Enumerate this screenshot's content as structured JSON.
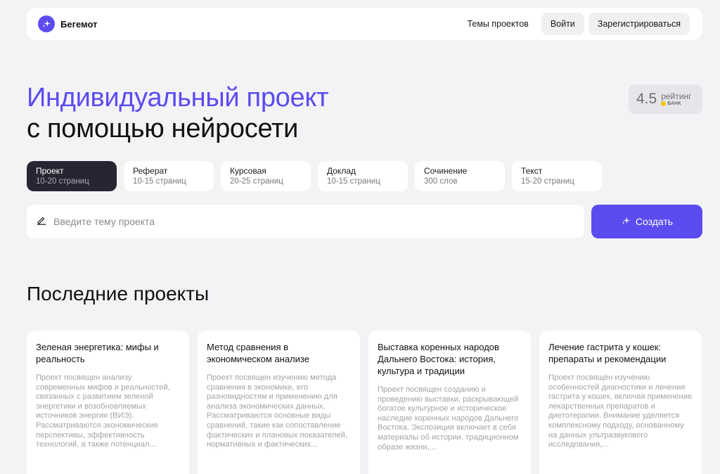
{
  "header": {
    "logo_text": "Бегемот",
    "nav_topics": "Темы проектов",
    "login": "Войти",
    "register": "Зарегистрироваться"
  },
  "hero": {
    "title_line1": "Индивидуальный проект",
    "title_line2": "с помощью нейросети"
  },
  "rating": {
    "value": "4.5",
    "label": "рейтинг",
    "bank": "БАНК"
  },
  "types": [
    {
      "name": "Проект",
      "sub": "10-20 страниц",
      "active": true
    },
    {
      "name": "Реферат",
      "sub": "10-15 страниц"
    },
    {
      "name": "Курсовая",
      "sub": "20-25 страниц"
    },
    {
      "name": "Доклад",
      "sub": "10-15 страниц"
    },
    {
      "name": "Сочинение",
      "sub": "300 слов"
    },
    {
      "name": "Текст",
      "sub": "15-20 страниц"
    }
  ],
  "search": {
    "placeholder": "Введите тему проекта",
    "create_label": "Создать"
  },
  "recent": {
    "title": "Последние проекты",
    "cards": [
      {
        "title": "Зеленая энергетика: мифы и реальность",
        "desc": "Проект посвящен анализу современных мифов и реальностей, связанных с развитием зеленой энергетики и возобновляемых источников энергии (ВИЭ). Рассматриваются экономические перспективы, эффективность технологий, а также потенциал..."
      },
      {
        "title": "Метод сравнения в экономическом анализе",
        "desc": "Проект посвящен изучению метода сравнения в экономике, его разновидностям и применению для анализа экономических данных. Рассматриваются основные виды сравнений, такие как сопоставление фактических и плановых показателей, нормативных и фактических..."
      },
      {
        "title": "Выставка коренных народов Дальнего Востока: история, культура и традиции",
        "desc": "Проект посвящен созданию и проведению выставки, раскрывающей богатое культурное и историческое наследие коренных народов Дальнего Востока. Экспозиция включает в себя материалы об истории, традиционном образе жизни,..."
      },
      {
        "title": "Лечение гастрита у кошек: препараты и рекомендации",
        "desc": "Проект посвящён изучению особенностей диагностики и лечения гастрита у кошек, включая применение лекарственных препаратов и диетотерапии. Внимание уделяется комплексному подходу, основанному на данных ультразвукового исследования,..."
      }
    ]
  }
}
